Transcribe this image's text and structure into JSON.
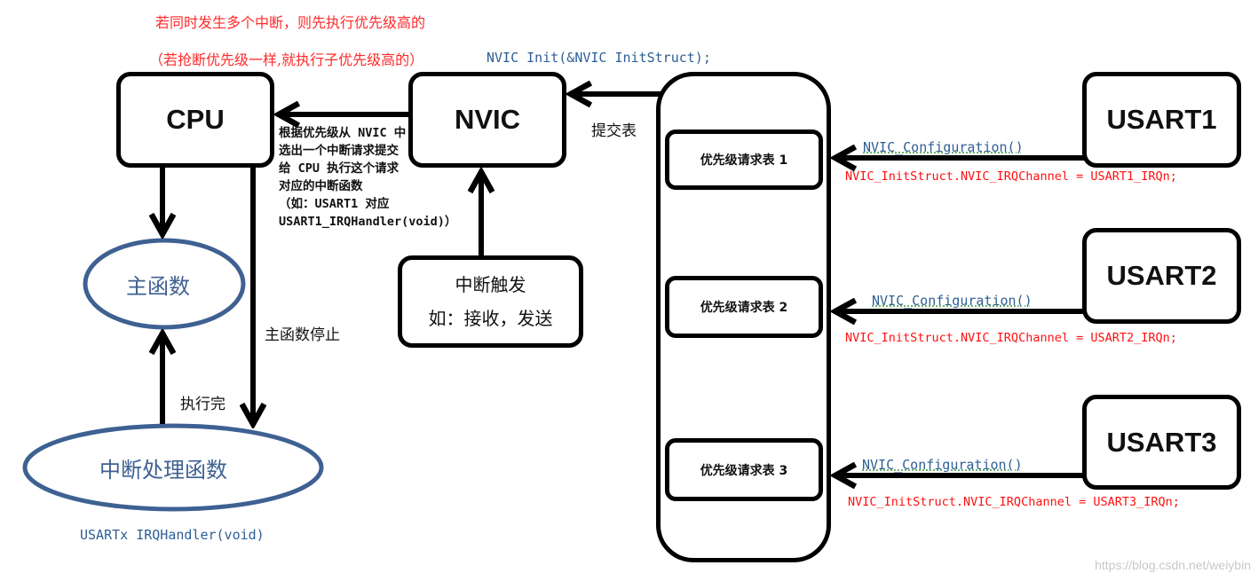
{
  "annotations": {
    "top_line1": "若同时发生多个中断，则先执行优先级高的",
    "top_line2": "（若抢断优先级一样,就执行子优先级高的）",
    "nvic_init_call": "NVIC Init(&NVIC InitStruct);"
  },
  "nodes": {
    "cpu": "CPU",
    "nvic": "NVIC",
    "main_function": "主函数",
    "isr": "中断处理函数",
    "isr_signature": "USARTx IRQHandler(void)",
    "interrupt_trigger": {
      "line1": "中断触发",
      "line2": "如：接收，发送"
    },
    "priority_tables": [
      {
        "label": "优先级请求表 1"
      },
      {
        "label": "优先级请求表 2"
      },
      {
        "label": "优先级请求表 3"
      }
    ],
    "usarts": [
      {
        "label": "USART1",
        "config_call": "NVIC_Configuration()",
        "channel_code": "NVIC_InitStruct.NVIC_IRQChannel = USART1_IRQn;"
      },
      {
        "label": "USART2",
        "config_call": "NVIC_Configuration()",
        "channel_code": "NVIC_InitStruct.NVIC_IRQChannel = USART2_IRQn;"
      },
      {
        "label": "USART3",
        "config_call": "NVIC_Configuration()",
        "channel_code": "NVIC_InitStruct.NVIC_IRQChannel = USART3_IRQn;"
      }
    ]
  },
  "edge_labels": {
    "nvic_to_cpu": "根据优先级从 NVIC 中选出一个中断请求提交给 CPU 执行这个请求对应的中断函数\n（如：USART1 对应 USART1_IRQHandler(void)）",
    "submit_table": "提交表",
    "main_stopped": "主函数停止",
    "finished": "执行完"
  },
  "watermark": "https://blog.csdn.net/weiybin",
  "colors": {
    "ellipse_stroke": "#3e6192",
    "annotation_red": "#ff2a2a",
    "code_blue": "#2f5f95",
    "code_red": "#ff1010"
  }
}
